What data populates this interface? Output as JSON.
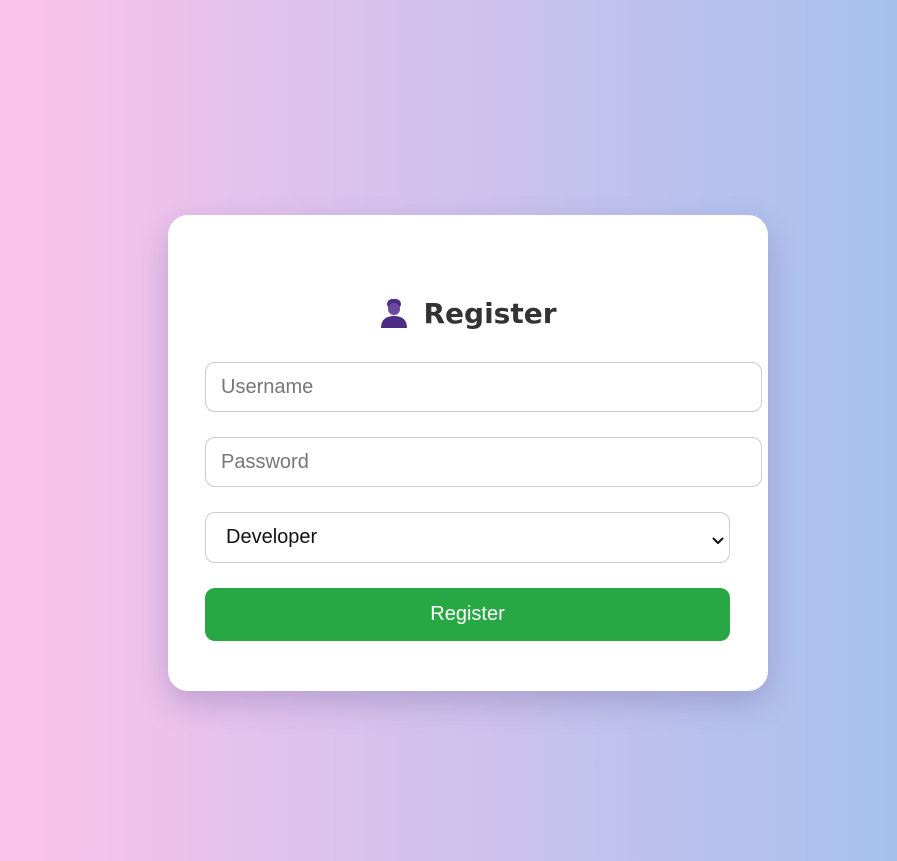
{
  "form": {
    "title": "Register",
    "title_icon": "user-icon",
    "username": {
      "placeholder": "Username",
      "value": ""
    },
    "password": {
      "placeholder": "Password",
      "value": ""
    },
    "role": {
      "selected": "Developer"
    },
    "submit_label": "Register"
  },
  "colors": {
    "background_start": "#fbc2eb",
    "background_end": "#a6c1ee",
    "card": "#ffffff",
    "title_text": "#333333",
    "icon": "#4b2e83",
    "submit_button": "#28a745",
    "submit_text": "#ffffff"
  }
}
